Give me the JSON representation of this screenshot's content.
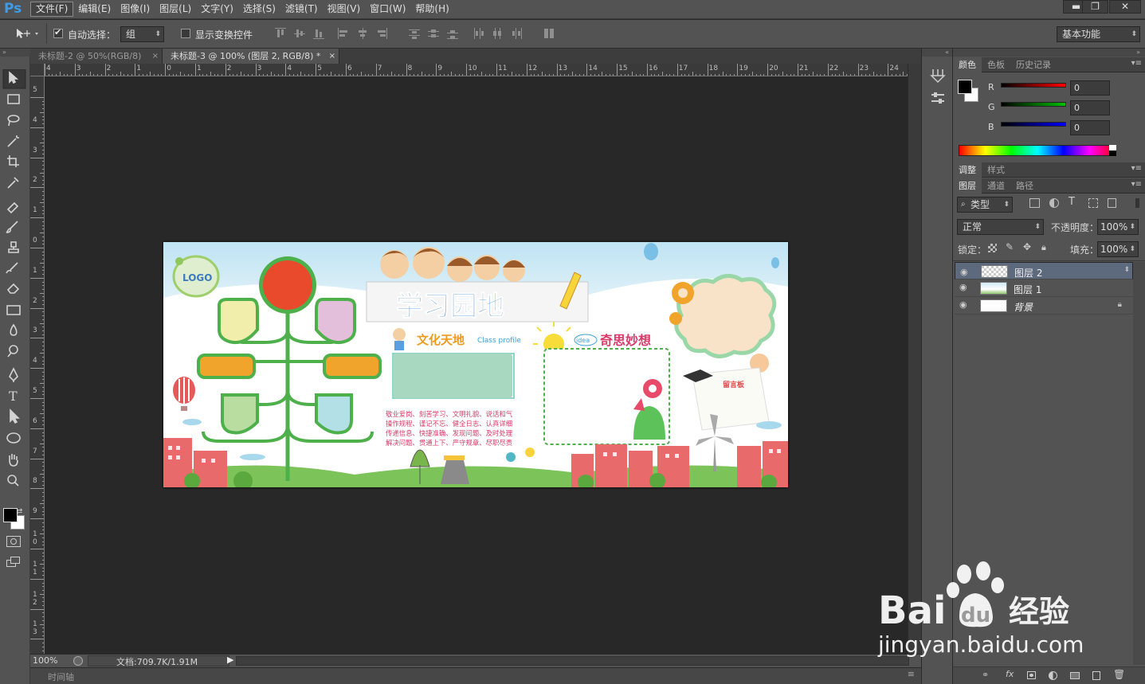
{
  "app": {
    "logo": "Ps"
  },
  "menubar": {
    "items": [
      "文件(F)",
      "编辑(E)",
      "图像(I)",
      "图层(L)",
      "文字(Y)",
      "选择(S)",
      "滤镜(T)",
      "视图(V)",
      "窗口(W)",
      "帮助(H)"
    ],
    "window_controls": [
      "▬",
      "❐",
      "✕"
    ]
  },
  "options": {
    "auto_select_label": "自动选择：",
    "auto_select_checked": true,
    "auto_select_value": "组",
    "show_transform_label": "显示变换控件",
    "show_transform_checked": false,
    "workspace": "基本功能"
  },
  "tabs": [
    {
      "label": "未标题-2 @ 50%(RGB/8)",
      "close": "×",
      "active": false
    },
    {
      "label": "未标题-3 @ 100% (图层 2, RGB/8) *",
      "close": "×",
      "active": true
    }
  ],
  "rulers": {
    "horizontal": [
      "4",
      "3",
      "2",
      "1",
      "0",
      "1",
      "2",
      "3",
      "4",
      "5",
      "6",
      "7",
      "8",
      "9",
      "10",
      "11",
      "12",
      "13",
      "14",
      "15",
      "16",
      "17",
      "18",
      "19",
      "20",
      "21",
      "22",
      "23",
      "24"
    ],
    "vertical": [
      "5",
      "4",
      "3",
      "2",
      "1",
      "0",
      "1",
      "2",
      "3",
      "4",
      "5",
      "6",
      "7",
      "8",
      "9",
      "10",
      "11",
      "12",
      "13"
    ]
  },
  "tools": [
    "move-tool-icon",
    "marquee-tool-icon",
    "lasso-tool-icon",
    "magic-wand-icon",
    "crop-tool-icon",
    "eyedropper-icon",
    "healing-brush-icon",
    "brush-tool-icon",
    "clone-stamp-icon",
    "history-brush-icon",
    "eraser-icon",
    "gradient-tool-icon",
    "blur-tool-icon",
    "dodge-tool-icon",
    "pen-tool-icon",
    "type-tool-icon",
    "path-select-icon",
    "ellipse-tool-icon",
    "hand-tool-icon",
    "zoom-tool-icon"
  ],
  "type_tool_glyph": "T",
  "status": {
    "zoom": "100%",
    "doc": "文档:709.7K/1.91M"
  },
  "timeline": {
    "label": "时间轴"
  },
  "color_panel": {
    "tabs": [
      "颜色",
      "色板",
      "历史记录"
    ],
    "channels": [
      {
        "label": "R",
        "value": "0",
        "color": "#ff0000"
      },
      {
        "label": "G",
        "value": "0",
        "color": "#00c000"
      },
      {
        "label": "B",
        "value": "0",
        "color": "#0000ff"
      }
    ]
  },
  "adjust_panel": {
    "tabs": [
      "调整",
      "样式"
    ]
  },
  "layers_panel": {
    "tabs": [
      "图层",
      "通道",
      "路径"
    ],
    "filter_kind": "类型",
    "blend_mode": "正常",
    "opacity_label": "不透明度：",
    "opacity": "100%",
    "lock_label": "锁定：",
    "fill_label": "填充：",
    "fill": "100%",
    "layers": [
      {
        "name": "图层 2",
        "selected": true,
        "locked": false
      },
      {
        "name": "图层 1",
        "selected": false,
        "locked": false
      },
      {
        "name": "背景",
        "selected": false,
        "locked": true
      }
    ],
    "footer_icons": [
      "link-icon",
      "fx-icon",
      "mask-icon",
      "adjustment-icon",
      "folder-icon",
      "new-layer-icon",
      "trash-icon"
    ],
    "fx_label": "fx"
  },
  "poster": {
    "logo_text": "LOGO",
    "title": "学习园地",
    "section1": "文化天地",
    "section1_sub": "Class profile",
    "section2": "奇思妙想",
    "idea_tag": "idea",
    "board": "留言板",
    "body_lines": [
      "敬业爱岗、刻苦学习、文明礼貌、说话和气",
      "操作规程、谨记不忘、健全日志、认真详细",
      "传递信息、快捷准确、发现问题、及时处理",
      "解决问题、贯通上下、严守规章、尽职尽责"
    ]
  },
  "watermark": {
    "brand": "Bai",
    "brand2": "du",
    "brand_cn": "经验",
    "url": "jingyan.baidu.com"
  }
}
